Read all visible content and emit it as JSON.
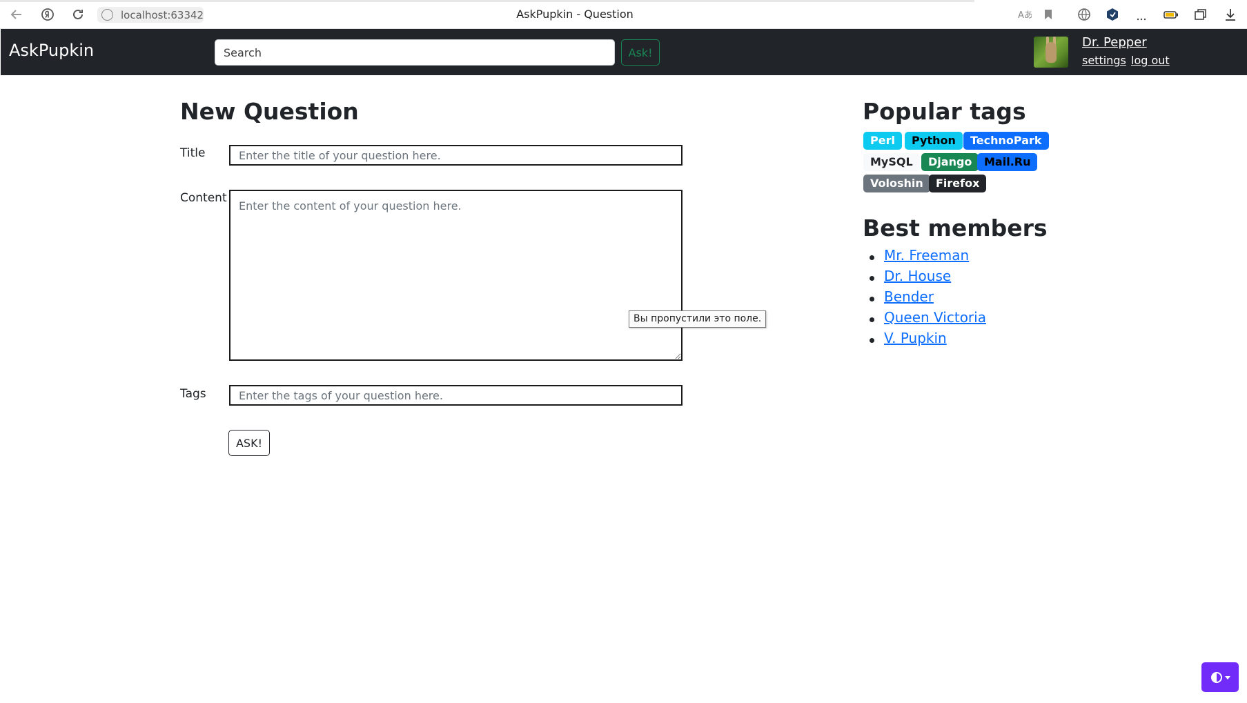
{
  "browser": {
    "url": "localhost:63342",
    "tab_title": "AskPupkin - Question"
  },
  "navbar": {
    "brand": "AskPupkin",
    "search_placeholder": "Search",
    "ask_label": "Ask!",
    "user": {
      "name": "Dr. Pepper",
      "settings_label": "settings",
      "logout_label": "log out"
    }
  },
  "form": {
    "heading": "New Question",
    "title_label": "Title",
    "title_placeholder": "Enter the title of your question here.",
    "content_label": "Content",
    "content_placeholder": "Enter the content of your question here.",
    "tags_label": "Tags",
    "tags_placeholder": "Enter the tags of your question here.",
    "submit_label": "ASK!",
    "validation_tooltip": "Вы пропустили это поле."
  },
  "sidebar": {
    "tags_heading": "Popular tags",
    "tags": [
      {
        "label": "Perl",
        "bg": "#0dcaf0",
        "fg": "#ffffff"
      },
      {
        "label": "Python",
        "bg": "#0dcaf0",
        "fg": "#000000"
      },
      {
        "label": "TechnoPark",
        "bg": "#0d6efd",
        "fg": "#ffffff"
      },
      {
        "label": "MySQL",
        "bg": "#f8f9fa",
        "fg": "#212529"
      },
      {
        "label": "Django",
        "bg": "#198754",
        "fg": "#ffffff"
      },
      {
        "label": "Mail.Ru",
        "bg": "#0d6efd",
        "fg": "#000000"
      },
      {
        "label": "Voloshin",
        "bg": "#6c757d",
        "fg": "#ffffff"
      },
      {
        "label": "Firefox",
        "bg": "#212529",
        "fg": "#ffffff"
      }
    ],
    "members_heading": "Best members",
    "members": [
      "Mr. Freeman",
      "Dr. House",
      "Bender",
      "Queen Victoria",
      "V. Pupkin"
    ]
  },
  "colors": {
    "navbar_bg": "#212529",
    "success": "#198754",
    "link": "#0d6efd",
    "theme_toggle": "#712cf9"
  }
}
